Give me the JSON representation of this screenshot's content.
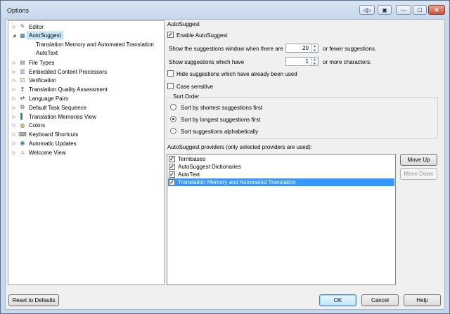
{
  "window": {
    "title": "Options",
    "controls": {
      "back": "◁▷",
      "pin": "▣",
      "minimize": "—",
      "maximize": "☐",
      "close": "✕"
    }
  },
  "tree": [
    {
      "label": "Editor",
      "icon": "pencil-icon",
      "glyph": "✎",
      "color": "#2f8a2f",
      "arrow": "▷",
      "selected": false
    },
    {
      "label": "AutoSuggest",
      "icon": "autosuggest-icon",
      "glyph": "▦",
      "color": "#3a64a8",
      "arrow": "◢",
      "selected": true,
      "children": [
        "Translation Memory and Automated Translation",
        "AutoText"
      ]
    },
    {
      "label": "File Types",
      "icon": "file-types-icon",
      "glyph": "▤",
      "color": "#6b6b6b",
      "arrow": "▷",
      "selected": false
    },
    {
      "label": "Embedded Content Processors",
      "icon": "embedded-content-icon",
      "glyph": "▥",
      "color": "#5b7fae",
      "arrow": "▷",
      "selected": false
    },
    {
      "label": "Verification",
      "icon": "verification-icon",
      "glyph": "☑",
      "color": "#3a7a3a",
      "arrow": "▷",
      "selected": false
    },
    {
      "label": "Translation Quality Assessment",
      "icon": "quality-assessment-icon",
      "glyph": "❢",
      "color": "#8a6a1a",
      "arrow": "▷",
      "selected": false
    },
    {
      "label": "Language Pairs",
      "icon": "language-pairs-icon",
      "glyph": "⇄",
      "color": "#2a4f8a",
      "arrow": "▷",
      "selected": false
    },
    {
      "label": "Default Task Sequence",
      "icon": "gear-icon",
      "glyph": "⚙",
      "color": "#555555",
      "arrow": "▷",
      "selected": false
    },
    {
      "label": "Translation Memories View",
      "icon": "tm-view-icon",
      "glyph": "▌",
      "color": "#2e8b57",
      "arrow": "▷",
      "selected": false
    },
    {
      "label": "Colors",
      "icon": "palette-icon",
      "glyph": "◍",
      "color": "#9a6a2a",
      "arrow": "▷",
      "selected": false
    },
    {
      "label": "Keyboard Shortcuts",
      "icon": "keyboard-icon",
      "glyph": "⌨",
      "color": "#555555",
      "arrow": "▷",
      "selected": false
    },
    {
      "label": "Automatic Updates",
      "icon": "globe-icon",
      "glyph": "◉",
      "color": "#2e6fb0",
      "arrow": "▷",
      "selected": false
    },
    {
      "label": "Welcome View",
      "icon": "home-icon",
      "glyph": "⌂",
      "color": "#b5652a",
      "arrow": "▷",
      "selected": false
    }
  ],
  "panel": {
    "heading": "AutoSuggest",
    "enable_label": "Enable AutoSuggest",
    "enable_checked": true,
    "window_row": {
      "prefix": "Show the suggestions window when there are",
      "value": "20",
      "suffix": "or fewer suggestions."
    },
    "chars_row": {
      "prefix": "Show suggestions which have",
      "value": "1",
      "suffix": "or more characters."
    },
    "hide_used_label": "Hide suggestions which have already been used",
    "hide_used_checked": false,
    "case_label": "Case sensitive",
    "case_checked": false,
    "sort_order": {
      "legend": "Sort Order",
      "options": [
        {
          "label": "Sort by shortest suggestions first",
          "selected": false
        },
        {
          "label": "Sort by longest suggestions first",
          "selected": true
        },
        {
          "label": "Sort suggestions alphabetically",
          "selected": false
        }
      ]
    },
    "providers_label": "AutoSuggest providers (only selected providers are used):",
    "providers": [
      {
        "label": "Termbases",
        "checked": true,
        "selected": false
      },
      {
        "label": "AutoSuggest Dictionaries",
        "checked": true,
        "selected": false
      },
      {
        "label": "AutoText",
        "checked": true,
        "selected": false
      },
      {
        "label": "Translation Memory and Automated Translation",
        "checked": true,
        "selected": true
      }
    ],
    "move_up": "Move Up",
    "move_down": "Move Down"
  },
  "footer": {
    "reset": "Reset to Defaults",
    "ok": "OK",
    "cancel": "Cancel",
    "help": "Help"
  }
}
